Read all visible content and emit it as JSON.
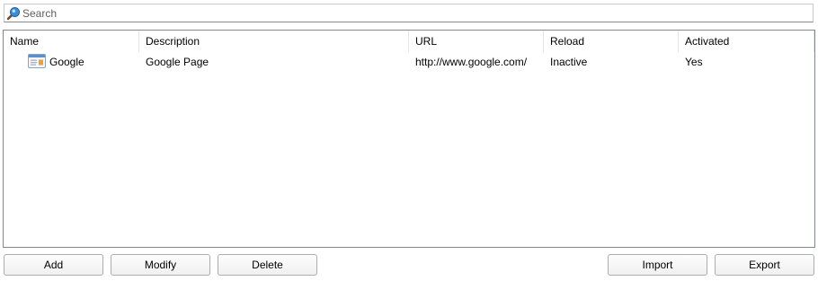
{
  "search": {
    "placeholder": "Search",
    "icon": "search-icon"
  },
  "table": {
    "columns": [
      "Name",
      "Description",
      "URL",
      "Reload",
      "Activated"
    ],
    "rows": [
      {
        "name": "Google",
        "description": "Google Page",
        "url": "http://www.google.com/",
        "reload": "Inactive",
        "activated": "Yes",
        "icon": "webpage-icon"
      }
    ]
  },
  "buttons": {
    "add": "Add",
    "modify": "Modify",
    "delete": "Delete",
    "import": "Import",
    "export": "Export"
  }
}
